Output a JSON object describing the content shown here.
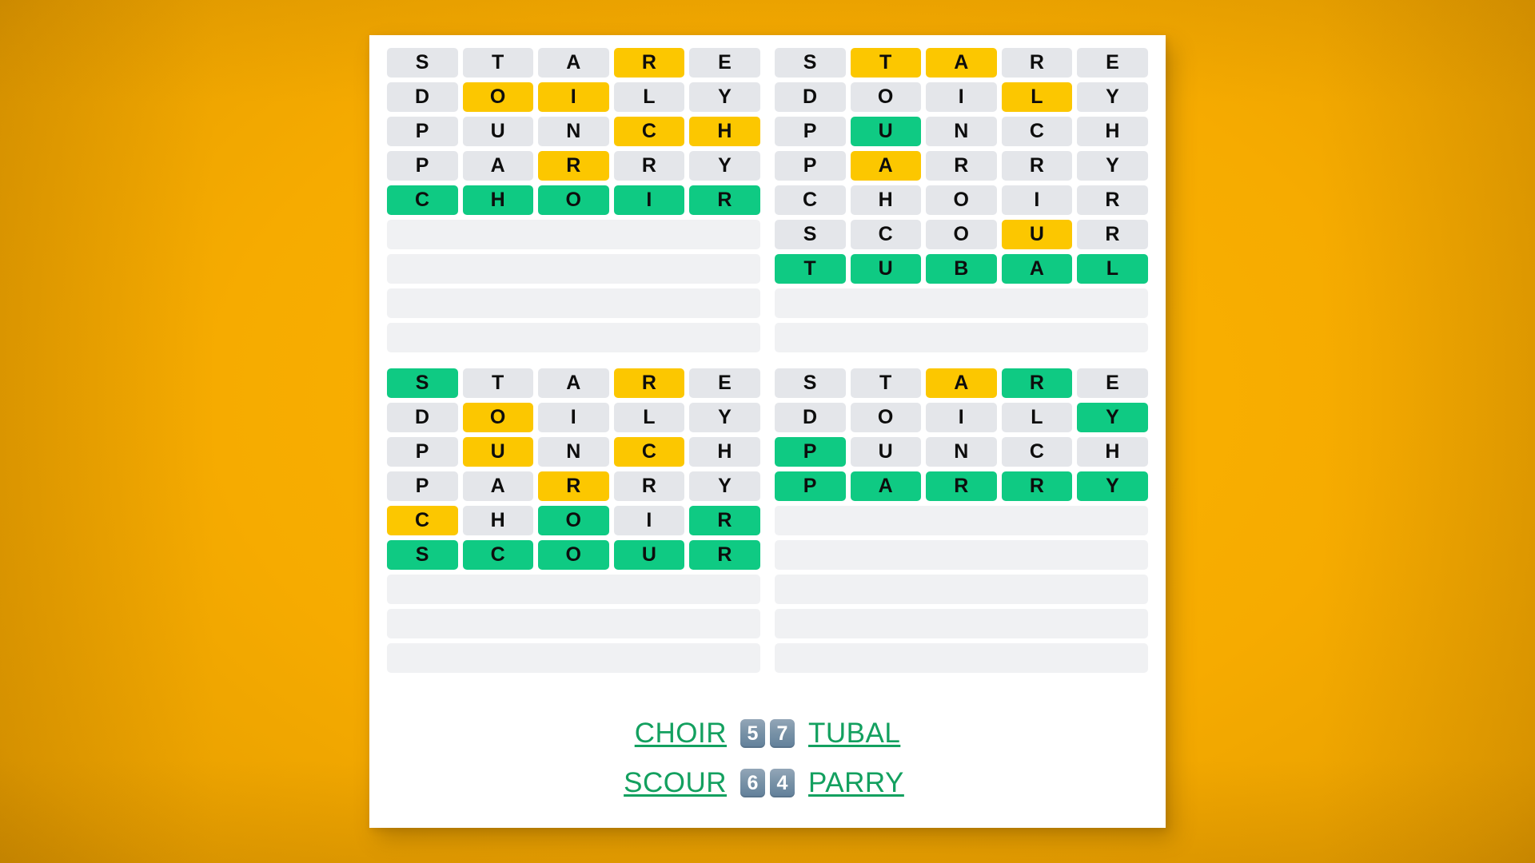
{
  "theme": {
    "background_color": "#f5ab00",
    "card_color": "#ffffff",
    "absent_color": "#e4e6ea",
    "present_color": "#fcc700",
    "correct_color": "#0fca83",
    "blank_color": "#f0f1f3",
    "answer_text_color": "#13a05f",
    "badge_color": "#7791a6"
  },
  "boards": [
    {
      "name": "board-top-left",
      "answer": "CHOIR",
      "guesses_used": 5,
      "rows": [
        {
          "letters": [
            "S",
            "T",
            "A",
            "R",
            "E"
          ],
          "states": [
            "absent",
            "absent",
            "absent",
            "present",
            "absent"
          ]
        },
        {
          "letters": [
            "D",
            "O",
            "I",
            "L",
            "Y"
          ],
          "states": [
            "absent",
            "present",
            "present",
            "absent",
            "absent"
          ]
        },
        {
          "letters": [
            "P",
            "U",
            "N",
            "C",
            "H"
          ],
          "states": [
            "absent",
            "absent",
            "absent",
            "present",
            "present"
          ]
        },
        {
          "letters": [
            "P",
            "A",
            "R",
            "R",
            "Y"
          ],
          "states": [
            "absent",
            "absent",
            "present",
            "absent",
            "absent"
          ]
        },
        {
          "letters": [
            "C",
            "H",
            "O",
            "I",
            "R"
          ],
          "states": [
            "correct",
            "correct",
            "correct",
            "correct",
            "correct"
          ]
        },
        {
          "letters": [
            "",
            "",
            "",
            "",
            ""
          ],
          "states": [
            "blank",
            "blank",
            "blank",
            "blank",
            "blank"
          ]
        },
        {
          "letters": [
            "",
            "",
            "",
            "",
            ""
          ],
          "states": [
            "blank",
            "blank",
            "blank",
            "blank",
            "blank"
          ]
        },
        {
          "letters": [
            "",
            "",
            "",
            "",
            ""
          ],
          "states": [
            "blank",
            "blank",
            "blank",
            "blank",
            "blank"
          ]
        },
        {
          "letters": [
            "",
            "",
            "",
            "",
            ""
          ],
          "states": [
            "blank",
            "blank",
            "blank",
            "blank",
            "blank"
          ]
        }
      ]
    },
    {
      "name": "board-top-right",
      "answer": "TUBAL",
      "guesses_used": 7,
      "rows": [
        {
          "letters": [
            "S",
            "T",
            "A",
            "R",
            "E"
          ],
          "states": [
            "absent",
            "present",
            "present",
            "absent",
            "absent"
          ]
        },
        {
          "letters": [
            "D",
            "O",
            "I",
            "L",
            "Y"
          ],
          "states": [
            "absent",
            "absent",
            "absent",
            "present",
            "absent"
          ]
        },
        {
          "letters": [
            "P",
            "U",
            "N",
            "C",
            "H"
          ],
          "states": [
            "absent",
            "correct",
            "absent",
            "absent",
            "absent"
          ]
        },
        {
          "letters": [
            "P",
            "A",
            "R",
            "R",
            "Y"
          ],
          "states": [
            "absent",
            "present",
            "absent",
            "absent",
            "absent"
          ]
        },
        {
          "letters": [
            "C",
            "H",
            "O",
            "I",
            "R"
          ],
          "states": [
            "absent",
            "absent",
            "absent",
            "absent",
            "absent"
          ]
        },
        {
          "letters": [
            "S",
            "C",
            "O",
            "U",
            "R"
          ],
          "states": [
            "absent",
            "absent",
            "absent",
            "present",
            "absent"
          ]
        },
        {
          "letters": [
            "T",
            "U",
            "B",
            "A",
            "L"
          ],
          "states": [
            "correct",
            "correct",
            "correct",
            "correct",
            "correct"
          ]
        },
        {
          "letters": [
            "",
            "",
            "",
            "",
            ""
          ],
          "states": [
            "blank",
            "blank",
            "blank",
            "blank",
            "blank"
          ]
        },
        {
          "letters": [
            "",
            "",
            "",
            "",
            ""
          ],
          "states": [
            "blank",
            "blank",
            "blank",
            "blank",
            "blank"
          ]
        }
      ]
    },
    {
      "name": "board-bottom-left",
      "answer": "SCOUR",
      "guesses_used": 6,
      "rows": [
        {
          "letters": [
            "S",
            "T",
            "A",
            "R",
            "E"
          ],
          "states": [
            "correct",
            "absent",
            "absent",
            "present",
            "absent"
          ]
        },
        {
          "letters": [
            "D",
            "O",
            "I",
            "L",
            "Y"
          ],
          "states": [
            "absent",
            "present",
            "absent",
            "absent",
            "absent"
          ]
        },
        {
          "letters": [
            "P",
            "U",
            "N",
            "C",
            "H"
          ],
          "states": [
            "absent",
            "present",
            "absent",
            "present",
            "absent"
          ]
        },
        {
          "letters": [
            "P",
            "A",
            "R",
            "R",
            "Y"
          ],
          "states": [
            "absent",
            "absent",
            "present",
            "absent",
            "absent"
          ]
        },
        {
          "letters": [
            "C",
            "H",
            "O",
            "I",
            "R"
          ],
          "states": [
            "present",
            "absent",
            "correct",
            "absent",
            "correct"
          ]
        },
        {
          "letters": [
            "S",
            "C",
            "O",
            "U",
            "R"
          ],
          "states": [
            "correct",
            "correct",
            "correct",
            "correct",
            "correct"
          ]
        },
        {
          "letters": [
            "",
            "",
            "",
            "",
            ""
          ],
          "states": [
            "blank",
            "blank",
            "blank",
            "blank",
            "blank"
          ]
        },
        {
          "letters": [
            "",
            "",
            "",
            "",
            ""
          ],
          "states": [
            "blank",
            "blank",
            "blank",
            "blank",
            "blank"
          ]
        },
        {
          "letters": [
            "",
            "",
            "",
            "",
            ""
          ],
          "states": [
            "blank",
            "blank",
            "blank",
            "blank",
            "blank"
          ]
        }
      ]
    },
    {
      "name": "board-bottom-right",
      "answer": "PARRY",
      "guesses_used": 4,
      "rows": [
        {
          "letters": [
            "S",
            "T",
            "A",
            "R",
            "E"
          ],
          "states": [
            "absent",
            "absent",
            "present",
            "correct",
            "absent"
          ]
        },
        {
          "letters": [
            "D",
            "O",
            "I",
            "L",
            "Y"
          ],
          "states": [
            "absent",
            "absent",
            "absent",
            "absent",
            "correct"
          ]
        },
        {
          "letters": [
            "P",
            "U",
            "N",
            "C",
            "H"
          ],
          "states": [
            "correct",
            "absent",
            "absent",
            "absent",
            "absent"
          ]
        },
        {
          "letters": [
            "P",
            "A",
            "R",
            "R",
            "Y"
          ],
          "states": [
            "correct",
            "correct",
            "correct",
            "correct",
            "correct"
          ]
        },
        {
          "letters": [
            "",
            "",
            "",
            "",
            ""
          ],
          "states": [
            "blank",
            "blank",
            "blank",
            "blank",
            "blank"
          ]
        },
        {
          "letters": [
            "",
            "",
            "",
            "",
            ""
          ],
          "states": [
            "blank",
            "blank",
            "blank",
            "blank",
            "blank"
          ]
        },
        {
          "letters": [
            "",
            "",
            "",
            "",
            ""
          ],
          "states": [
            "blank",
            "blank",
            "blank",
            "blank",
            "blank"
          ]
        },
        {
          "letters": [
            "",
            "",
            "",
            "",
            ""
          ],
          "states": [
            "blank",
            "blank",
            "blank",
            "blank",
            "blank"
          ]
        },
        {
          "letters": [
            "",
            "",
            "",
            "",
            ""
          ],
          "states": [
            "blank",
            "blank",
            "blank",
            "blank",
            "blank"
          ]
        }
      ]
    }
  ],
  "footer": {
    "answer_rows": [
      {
        "left_word": "CHOIR",
        "left_score": "5",
        "right_score": "7",
        "right_word": "TUBAL"
      },
      {
        "left_word": "SCOUR",
        "left_score": "6",
        "right_score": "4",
        "right_word": "PARRY"
      }
    ]
  }
}
